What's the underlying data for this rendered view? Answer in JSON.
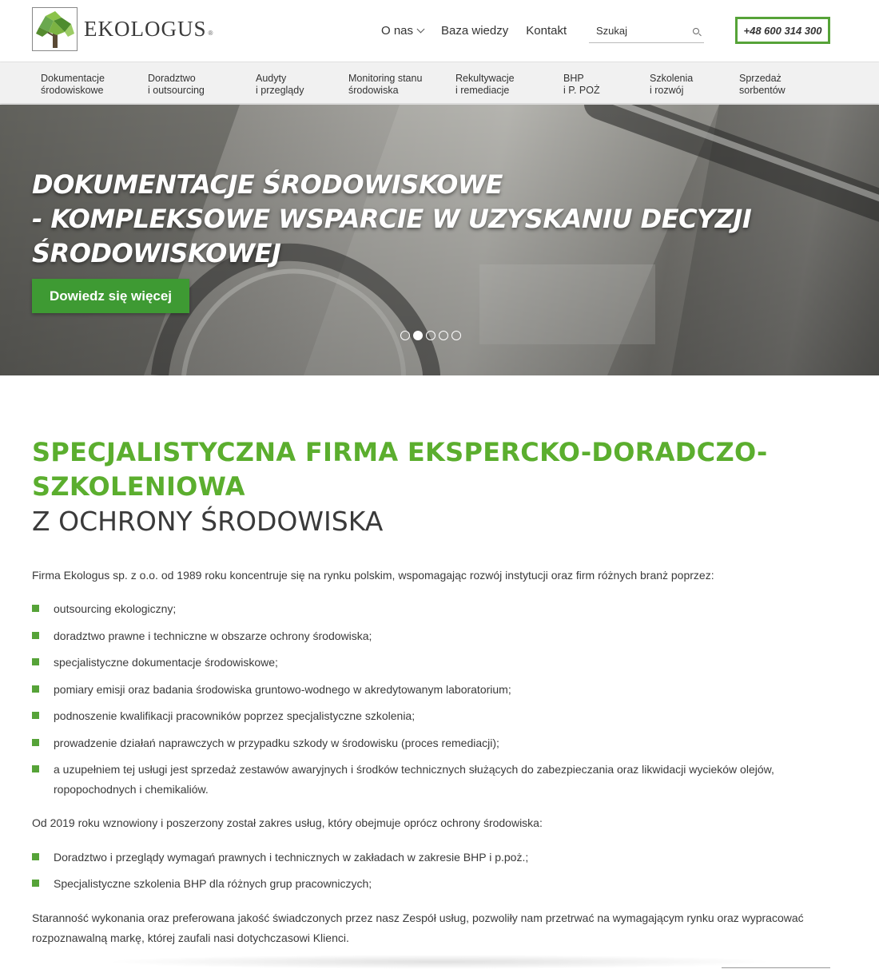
{
  "brand": {
    "name": "EKOLOGUS",
    "reg": "®"
  },
  "topnav": {
    "about": "O nas",
    "knowledge": "Baza wiedzy",
    "contact": "Kontakt"
  },
  "search": {
    "placeholder": "Szukaj"
  },
  "phone": "+48 600 314 300",
  "services": [
    {
      "l1": "Dokumentacje",
      "l2": "środowiskowe"
    },
    {
      "l1": "Doradztwo",
      "l2": "i outsourcing"
    },
    {
      "l1": "Audyty",
      "l2": "i przeglądy"
    },
    {
      "l1": "Monitoring stanu",
      "l2": "środowiska"
    },
    {
      "l1": "Rekultywacje",
      "l2": "i remediacje"
    },
    {
      "l1": "BHP",
      "l2": "i P. POŻ"
    },
    {
      "l1": "Szkolenia",
      "l2": "i rozwój"
    },
    {
      "l1": "Sprzedaż",
      "l2": "sorbentów"
    }
  ],
  "hero": {
    "line1": "DOKUMENTACJE ŚRODOWISKOWE",
    "line2": "- KOMPLEKSOWE WSPARCIE W UZYSKANIU DECYZJI",
    "line3": "ŚRODOWISKOWEJ",
    "button": "Dowiedz się więcej",
    "slides": 5,
    "active_slide": 2
  },
  "heading": {
    "green1": "SPECJALISTYCZNA FIRMA EKSPERCKO-DORADCZO-",
    "green2": "SZKOLENIOWA",
    "dark": "Z OCHRONY ŚRODOWISKA"
  },
  "intro": "Firma Ekologus sp. z o.o. od 1989 roku koncentruje się na rynku polskim, wspomagając rozwój instytucji oraz firm różnych branż poprzez:",
  "list1": [
    "outsourcing ekologiczny;",
    "doradztwo prawne i techniczne w obszarze ochrony środowiska;",
    "specjalistyczne dokumentacje środowiskowe;",
    "pomiary emisji oraz badania środowiska gruntowo-wodnego w akredytowanym laboratorium;",
    "podnoszenie kwalifikacji pracowników poprzez specjalistyczne szkolenia;",
    "prowadzenie działań naprawczych w przypadku szkody w środowisku (proces remediacji);",
    "a uzupełniem tej usługi jest sprzedaż zestawów awaryjnych i środków technicznych służących do zabezpieczania oraz likwidacji wycieków olejów, ropopochodnych i chemikaliów."
  ],
  "para2": "Od 2019 roku wznowiony i poszerzony został zakres usług, który obejmuje oprócz ochrony środowiska:",
  "list2": [
    "Doradztwo i przeglądy wymagań prawnych i technicznych w zakładach w zakresie BHP i p.poż.;",
    "Specjalistyczne szkolenia BHP dla różnych grup pracowniczych;"
  ],
  "para3": "Staranność wykonania oraz preferowana jakość świadczonych przez nasz Zespół usług, pozwoliły nam przetrwać na wymagającym rynku oraz wypracować rozpoznawalną markę, której zaufali nasi dotychczasowi Klienci.",
  "colors": {
    "accent": "#56a338",
    "heading_green": "#5bae2e",
    "button_green": "#3e9a33"
  }
}
